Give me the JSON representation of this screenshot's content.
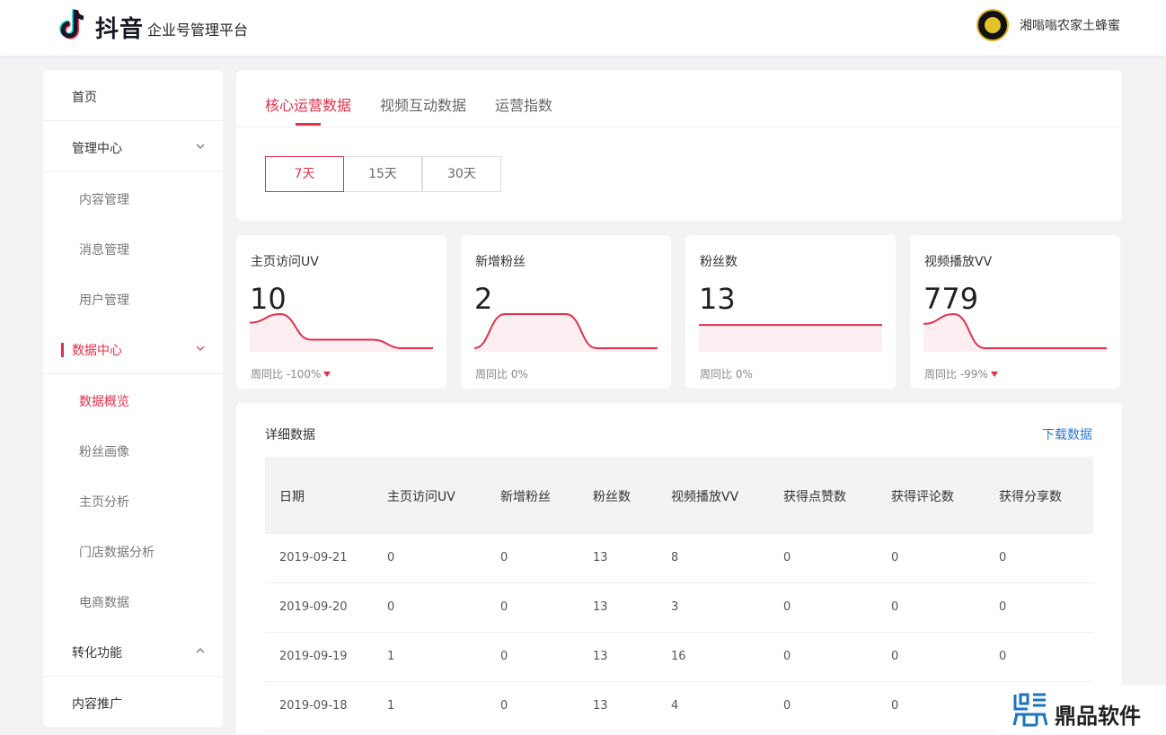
{
  "header": {
    "brand": "抖音",
    "platform": "企业号管理平台",
    "username": "湘嗡嗡农家土蜂蜜"
  },
  "sidebar": {
    "items": [
      {
        "label": "首页"
      },
      {
        "label": "管理中心"
      },
      {
        "label": "内容管理"
      },
      {
        "label": "消息管理"
      },
      {
        "label": "用户管理"
      },
      {
        "label": "数据中心"
      },
      {
        "label": "数据概览"
      },
      {
        "label": "粉丝画像"
      },
      {
        "label": "主页分析"
      },
      {
        "label": "门店数据分析"
      },
      {
        "label": "电商数据"
      },
      {
        "label": "转化功能"
      },
      {
        "label": "内容推广"
      }
    ]
  },
  "tabs": [
    "核心运营数据",
    "视频互动数据",
    "运营指数"
  ],
  "ranges": [
    "7天",
    "15天",
    "30天"
  ],
  "metrics": [
    {
      "label": "主页访问UV",
      "value": "10",
      "foot": "周同比  -100%",
      "trend": [
        3,
        4,
        1,
        1,
        1,
        0,
        0
      ]
    },
    {
      "label": "新增粉丝",
      "value": "2",
      "foot": "周同比  0%",
      "trend": [
        0,
        1,
        1,
        1,
        0,
        0,
        0
      ]
    },
    {
      "label": "粉丝数",
      "value": "13",
      "foot": "周同比  0%",
      "trend": [
        13,
        13,
        13,
        13,
        13,
        13,
        13
      ]
    },
    {
      "label": "视频播放VV",
      "value": "779",
      "foot": "周同比  -99%",
      "trend": [
        6,
        8,
        1,
        1,
        1,
        1,
        1
      ]
    }
  ],
  "detail": {
    "title": "详细数据",
    "download": "下载数据",
    "columns": [
      "日期",
      "主页访问UV",
      "新增粉丝",
      "粉丝数",
      "视频播放VV",
      "获得点赞数",
      "获得评论数",
      "获得分享数"
    ],
    "rows": [
      [
        "2019-09-21",
        "0",
        "0",
        "13",
        "8",
        "0",
        "0",
        "0"
      ],
      [
        "2019-09-20",
        "0",
        "0",
        "13",
        "3",
        "0",
        "0",
        "0"
      ],
      [
        "2019-09-19",
        "1",
        "0",
        "13",
        "16",
        "0",
        "0",
        "0"
      ],
      [
        "2019-09-18",
        "1",
        "0",
        "13",
        "4",
        "0",
        "0",
        ""
      ]
    ]
  },
  "watermark": {
    "text": "鼎品软件"
  },
  "colors": {
    "accent": "#e0304a",
    "link": "#2a7ad2"
  }
}
